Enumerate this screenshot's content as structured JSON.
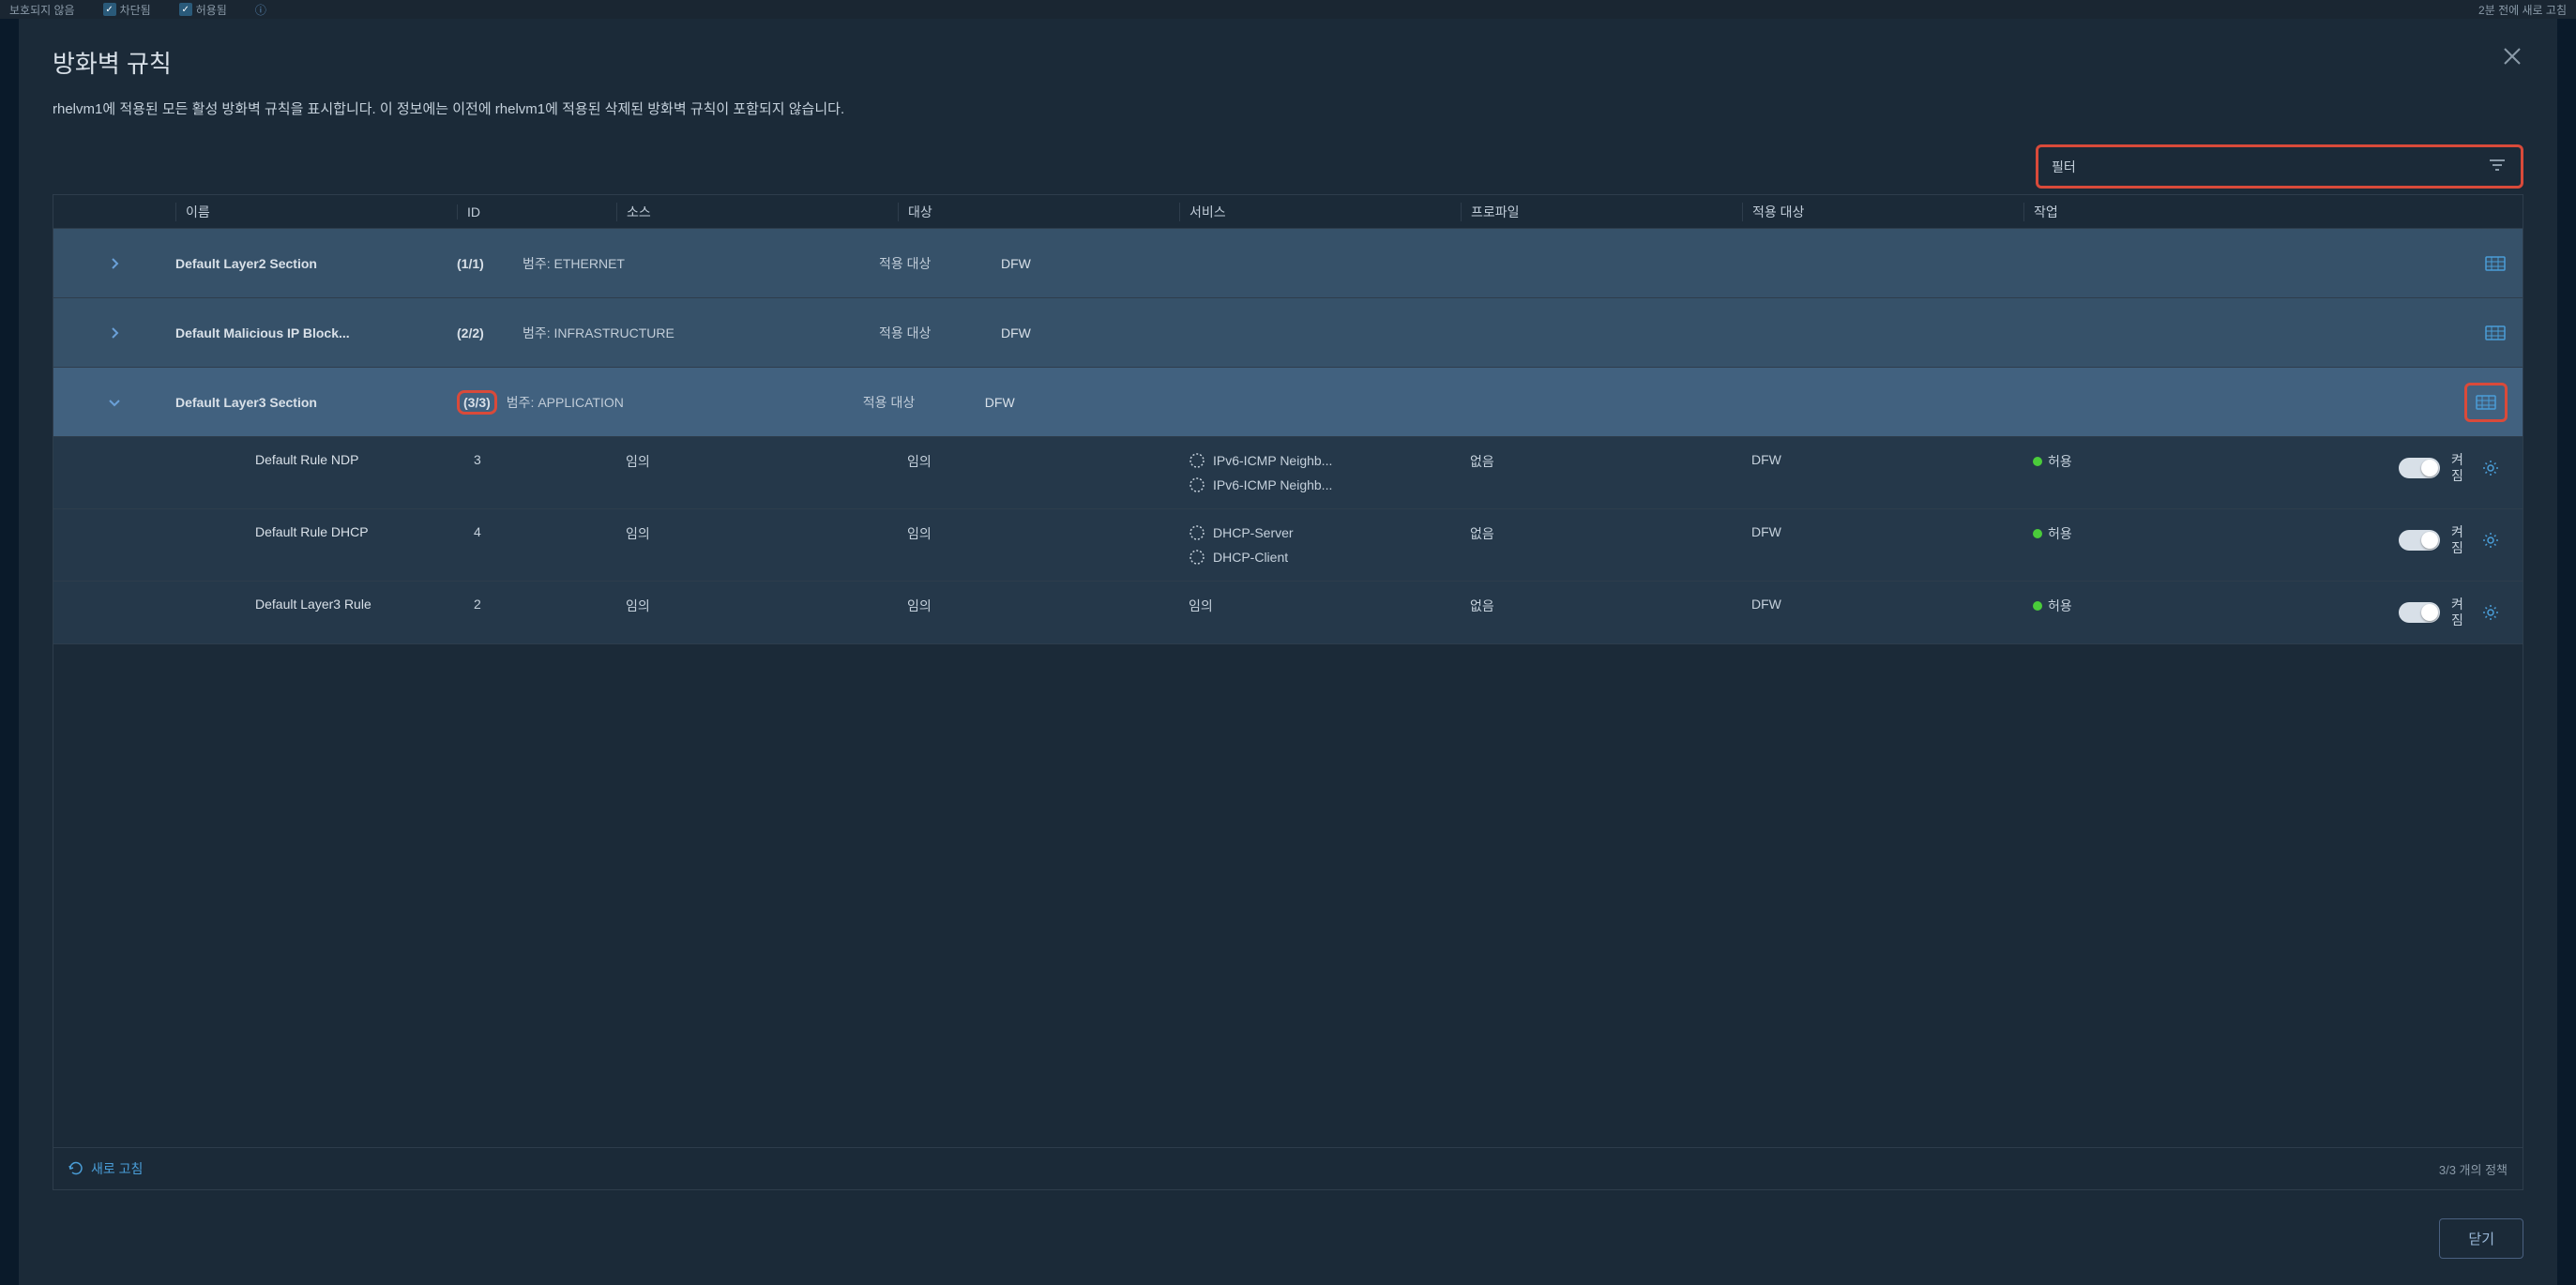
{
  "backdrop": {
    "unprotected": "보호되지 않음",
    "blocked": "차단됨",
    "allowed": "허용됨",
    "refresh": "2분 전에 새로 고침"
  },
  "dialog": {
    "title": "방화벽 규칙",
    "desc": "rhelvm1에 적용된 모든 활성 방화벽 규칙을 표시합니다. 이 정보에는 이전에 rhelvm1에 적용된 삭제된 방화벽 규칙이 포함되지 않습니다.",
    "filter_label": "필터",
    "close": "닫기"
  },
  "headers": {
    "name": "이름",
    "id": "ID",
    "source": "소스",
    "dest": "대상",
    "service": "서비스",
    "profile": "프로파일",
    "applied": "적용 대상",
    "action": "작업"
  },
  "sections": [
    {
      "name": "Default Layer2 Section",
      "count": "(1/1)",
      "scope": "범주: ETHERNET",
      "applied_label": "적용 대상",
      "applied_value": "DFW",
      "expanded": false,
      "highlight_count": false,
      "highlight_icon": false
    },
    {
      "name": "Default Malicious IP Block...",
      "count": "(2/2)",
      "scope": "범주: INFRASTRUCTURE",
      "applied_label": "적용 대상",
      "applied_value": "DFW",
      "expanded": false,
      "highlight_count": false,
      "highlight_icon": false
    },
    {
      "name": "Default Layer3 Section",
      "count": "(3/3)",
      "scope": "범주: APPLICATION",
      "applied_label": "적용 대상",
      "applied_value": "DFW",
      "expanded": true,
      "highlight_count": true,
      "highlight_icon": true
    }
  ],
  "rules": [
    {
      "name": "Default Rule NDP",
      "id": "3",
      "src": "임의",
      "dst": "임의",
      "services": [
        "IPv6-ICMP Neighb...",
        "IPv6-ICMP Neighb..."
      ],
      "svc_is_text": false,
      "profile": "없음",
      "applied": "DFW",
      "action": "허용",
      "toggle": "켜짐"
    },
    {
      "name": "Default Rule DHCP",
      "id": "4",
      "src": "임의",
      "dst": "임의",
      "services": [
        "DHCP-Server",
        "DHCP-Client"
      ],
      "svc_is_text": false,
      "profile": "없음",
      "applied": "DFW",
      "action": "허용",
      "toggle": "켜짐"
    },
    {
      "name": "Default Layer3 Rule",
      "id": "2",
      "src": "임의",
      "dst": "임의",
      "svc_text": "임의",
      "svc_is_text": true,
      "profile": "없음",
      "applied": "DFW",
      "action": "허용",
      "toggle": "켜짐"
    }
  ],
  "footer": {
    "refresh": "새로 고침",
    "policy_count": "3/3 개의 정책"
  }
}
